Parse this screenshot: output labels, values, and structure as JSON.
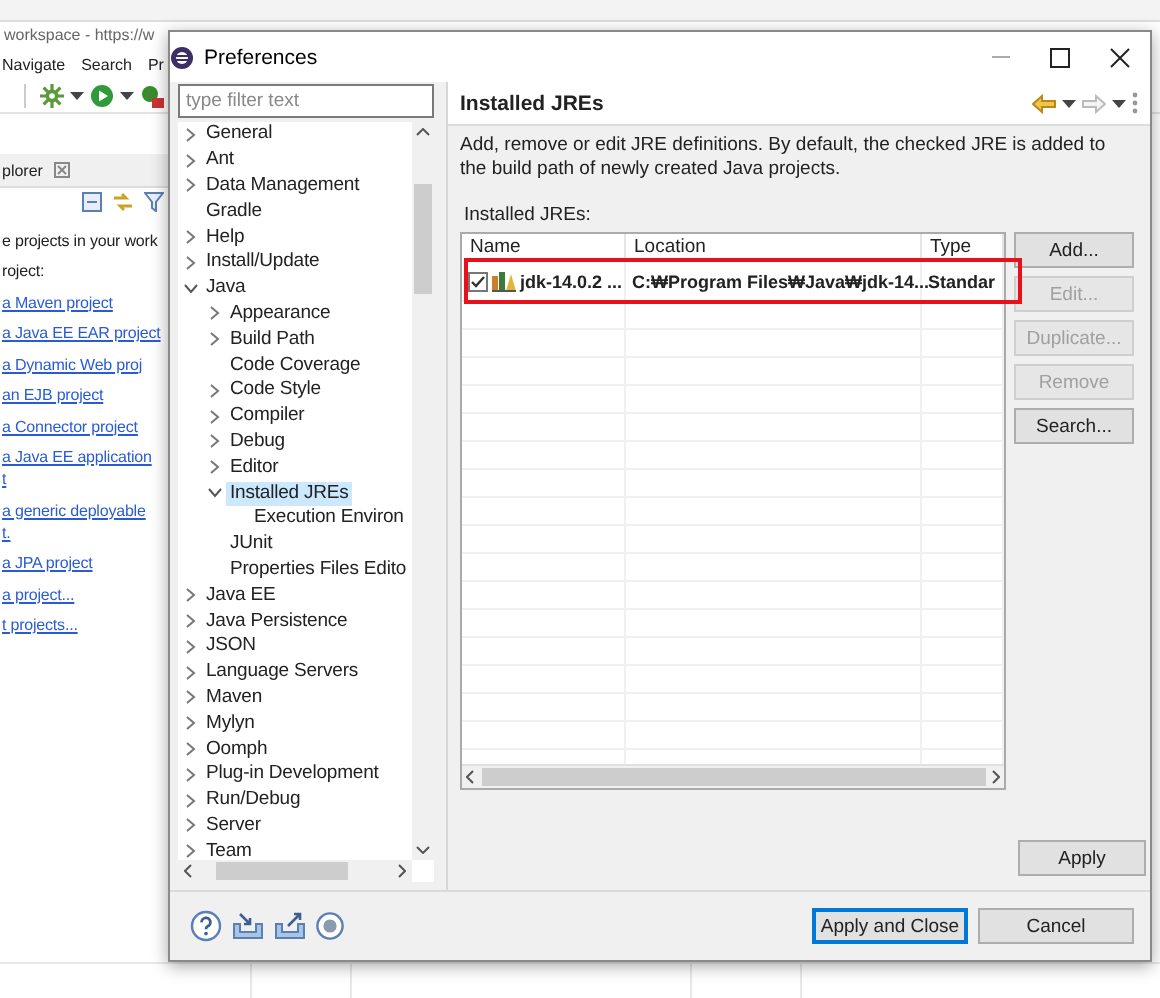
{
  "workbench": {
    "title": "workspace - https://w",
    "menu": [
      "Navigate",
      "Search",
      "Pr"
    ],
    "explorer": {
      "tab": "plorer",
      "lines": [
        {
          "kind": "text",
          "text": "e projects in your work"
        },
        {
          "kind": "text",
          "text": "roject:"
        },
        {
          "kind": "link",
          "text": "a Maven project"
        },
        {
          "kind": "link",
          "text": "a Java EE EAR project"
        },
        {
          "kind": "link",
          "text": "a Dynamic Web proj"
        },
        {
          "kind": "link",
          "text": "an EJB project"
        },
        {
          "kind": "link",
          "text": "a Connector project"
        },
        {
          "kind": "link",
          "text": "a Java EE application"
        },
        {
          "kind": "link-wrap",
          "text": "t"
        },
        {
          "kind": "link",
          "text": "a generic deployable"
        },
        {
          "kind": "link-wrap",
          "text": "t."
        },
        {
          "kind": "link",
          "text": "a JPA project"
        },
        {
          "kind": "link",
          "text": "a project..."
        },
        {
          "kind": "link",
          "text": "t projects..."
        }
      ]
    }
  },
  "dialog": {
    "title": "Preferences",
    "filter": {
      "placeholder": "type filter text"
    },
    "tree": [
      {
        "label": "General",
        "expandable": true,
        "expanded": false,
        "selected": false
      },
      {
        "label": "Ant",
        "expandable": true,
        "expanded": false,
        "selected": false
      },
      {
        "label": "Data Management",
        "expandable": true,
        "expanded": false,
        "selected": false
      },
      {
        "label": "Gradle",
        "expandable": false,
        "expanded": false,
        "selected": false
      },
      {
        "label": "Help",
        "expandable": true,
        "expanded": false,
        "selected": false
      },
      {
        "label": "Install/Update",
        "expandable": true,
        "expanded": false,
        "selected": false
      },
      {
        "label": "Java",
        "expandable": true,
        "expanded": true,
        "selected": false,
        "children": [
          {
            "label": "Appearance",
            "expandable": true,
            "expanded": false,
            "selected": false
          },
          {
            "label": "Build Path",
            "expandable": true,
            "expanded": false,
            "selected": false
          },
          {
            "label": "Code Coverage",
            "expandable": false,
            "expanded": false,
            "selected": false
          },
          {
            "label": "Code Style",
            "expandable": true,
            "expanded": false,
            "selected": false
          },
          {
            "label": "Compiler",
            "expandable": true,
            "expanded": false,
            "selected": false
          },
          {
            "label": "Debug",
            "expandable": true,
            "expanded": false,
            "selected": false
          },
          {
            "label": "Editor",
            "expandable": true,
            "expanded": false,
            "selected": false
          },
          {
            "label": "Installed JREs",
            "expandable": true,
            "expanded": true,
            "selected": true,
            "children": [
              {
                "label": "Execution Environ",
                "expandable": false,
                "expanded": false,
                "selected": false
              }
            ]
          },
          {
            "label": "JUnit",
            "expandable": false,
            "expanded": false,
            "selected": false
          },
          {
            "label": "Properties Files Edito",
            "expandable": false,
            "expanded": false,
            "selected": false
          }
        ]
      },
      {
        "label": "Java EE",
        "expandable": true,
        "expanded": false,
        "selected": false
      },
      {
        "label": "Java Persistence",
        "expandable": true,
        "expanded": false,
        "selected": false
      },
      {
        "label": "JSON",
        "expandable": true,
        "expanded": false,
        "selected": false
      },
      {
        "label": "Language Servers",
        "expandable": true,
        "expanded": false,
        "selected": false
      },
      {
        "label": "Maven",
        "expandable": true,
        "expanded": false,
        "selected": false
      },
      {
        "label": "Mylyn",
        "expandable": true,
        "expanded": false,
        "selected": false
      },
      {
        "label": "Oomph",
        "expandable": true,
        "expanded": false,
        "selected": false
      },
      {
        "label": "Plug-in Development",
        "expandable": true,
        "expanded": false,
        "selected": false
      },
      {
        "label": "Run/Debug",
        "expandable": true,
        "expanded": false,
        "selected": false
      },
      {
        "label": "Server",
        "expandable": true,
        "expanded": false,
        "selected": false
      },
      {
        "label": "Team",
        "expandable": true,
        "expanded": false,
        "selected": false
      }
    ],
    "page": {
      "title": "Installed JREs",
      "description": "Add, remove or edit JRE definitions. By default, the checked JRE is added to the build path of newly created Java projects.",
      "table_label": "Installed JREs:",
      "columns": [
        "Name",
        "Location",
        "Type"
      ],
      "rows": [
        {
          "checked": true,
          "highlighted": true,
          "name": "jdk-14.0.2 ...",
          "location": "C:₩Program Files₩Java₩jdk-14...",
          "type": "Standar"
        }
      ],
      "buttons": [
        {
          "label": "Add...",
          "disabled": false
        },
        {
          "label": "Edit...",
          "disabled": true
        },
        {
          "label": "Duplicate...",
          "disabled": true
        },
        {
          "label": "Remove",
          "disabled": true
        },
        {
          "label": "Search...",
          "disabled": false
        }
      ],
      "apply": "Apply"
    },
    "footer_buttons": [
      {
        "label": "Apply and Close",
        "default": true
      },
      {
        "label": "Cancel",
        "default": false
      }
    ]
  }
}
